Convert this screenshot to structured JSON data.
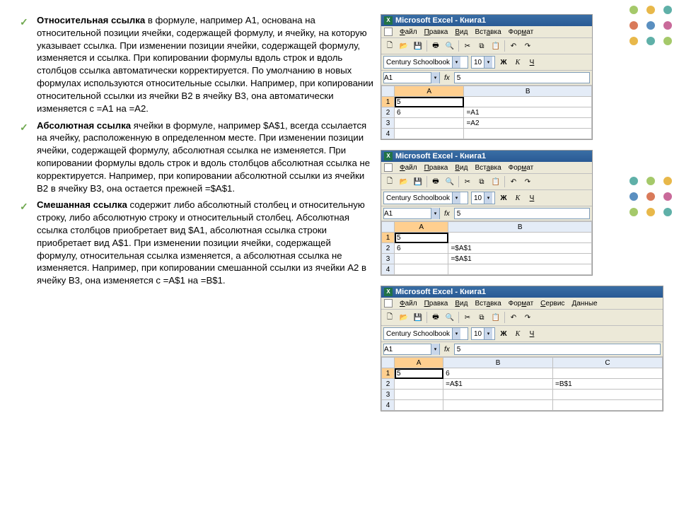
{
  "bullets": [
    {
      "title": "Относительная ссылка",
      "body": " в формуле, например A1, основана на относительной позиции ячейки, содержащей формулу, и ячейку, на которую указывает ссылка. При изменении позиции ячейки, содержащей формулу, изменяется и ссылка. При копировании формулы вдоль строк и вдоль столбцов ссылка автоматически корректируется. По умолчанию в новых формулах используются относительные ссылки. Например, при копировании относительной ссылки из ячейки B2 в ячейку B3, она автоматически изменяется с =A1 на =A2."
    },
    {
      "title": "Абсолютная ссылка",
      "body": "  ячейки в формуле, например $A$1, всегда ссылается на ячейку, расположенную в определенном месте. При изменении позиции ячейки, содержащей формулу, абсолютная ссылка не изменяется. При копировании формулы вдоль строк и вдоль столбцов абсолютная ссылка не корректируется. Например, при копировании абсолютной ссылки из ячейки B2 в ячейку B3, она остается прежней =$A$1."
    },
    {
      "title": "Смешанная ссылка",
      "body": " содержит либо абсолютный столбец и относительную строку, либо абсолютную строку и относительный столбец. Абсолютная ссылка столбцов приобретает вид $A1, абсолютная ссылка строки приобретает вид A$1. При изменении позиции ячейки, содержащей формулу, относительная ссылка изменяется, а абсолютная ссылка не изменяется. Например, при копировании смешанной ссылки из ячейки A2 в ячейку B3, она изменяется с =A$1 на =B$1."
    }
  ],
  "excel": {
    "title": "Microsoft Excel - Книга1",
    "menu": {
      "file": "Файл",
      "edit": "Правка",
      "view": "Вид",
      "insert": "Вставка",
      "format": "Формат",
      "tools": "Сервис",
      "data": "Данные"
    },
    "font": "Century Schoolbook",
    "fontSize": "10",
    "bold": "Ж",
    "italic": "К",
    "underline": "Ч",
    "cellRef": "A1",
    "fx": "fx",
    "formulaVal": "5",
    "cols2": [
      "A",
      "B"
    ],
    "cols3": [
      "A",
      "B",
      "C"
    ],
    "shot1": {
      "rows": [
        [
          "5",
          ""
        ],
        [
          "6",
          "=A1"
        ],
        [
          "",
          "=A2"
        ],
        [
          "",
          ""
        ]
      ]
    },
    "shot2": {
      "rows": [
        [
          "5",
          ""
        ],
        [
          "6",
          "=$A$1"
        ],
        [
          "",
          "=$A$1"
        ],
        [
          "",
          ""
        ]
      ]
    },
    "shot3": {
      "rows": [
        [
          "5",
          "6",
          ""
        ],
        [
          "",
          "=A$1",
          "=B$1"
        ],
        [
          "",
          "",
          ""
        ],
        [
          "",
          "",
          ""
        ]
      ]
    }
  }
}
